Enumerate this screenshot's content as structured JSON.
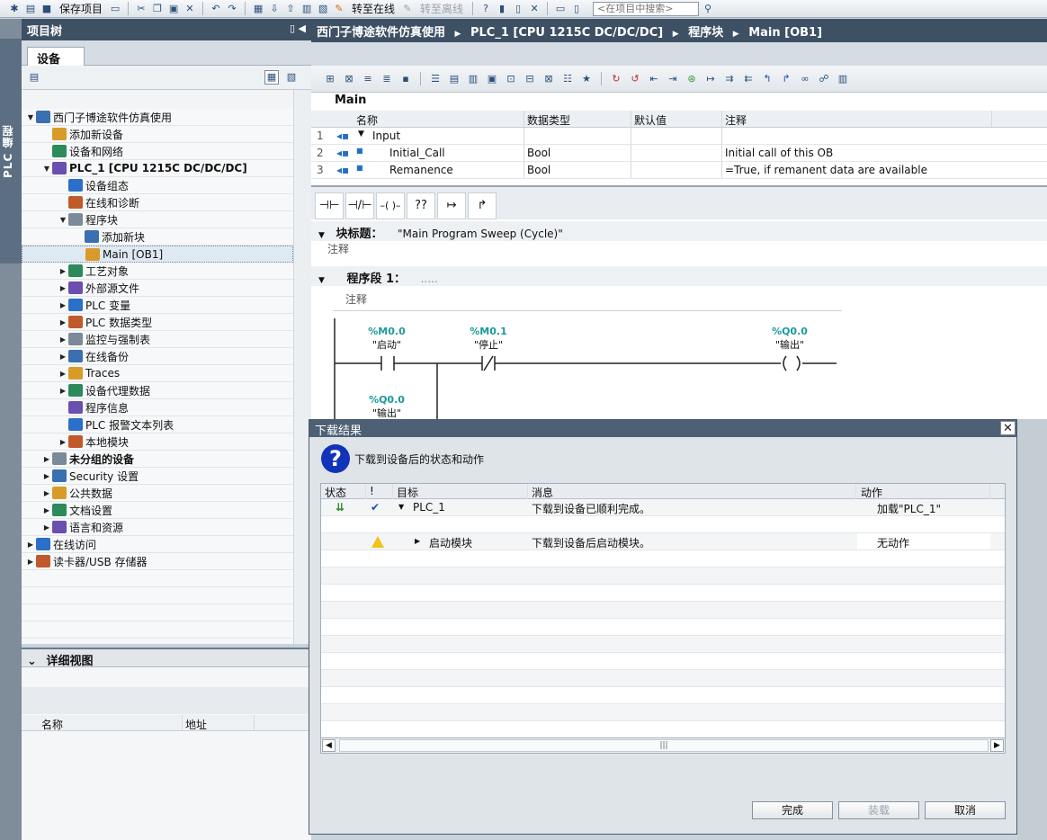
{
  "toolbar": {
    "save_project": "保存项目",
    "go_online": "转至在线",
    "go_offline": "转至离线",
    "search_placeholder": "<在项目中搜索>"
  },
  "left_strip": {
    "label": "PLC 编程"
  },
  "project_tree": {
    "title": "项目树",
    "tab": "设备",
    "items": [
      {
        "label": "西门子博途软件仿真使用",
        "level": 0,
        "expander": "down"
      },
      {
        "label": "添加新设备",
        "level": 1,
        "expander": ""
      },
      {
        "label": "设备和网络",
        "level": 1,
        "expander": ""
      },
      {
        "label": "PLC_1 [CPU 1215C DC/DC/DC]",
        "level": 1,
        "expander": "down",
        "bold": true
      },
      {
        "label": "设备组态",
        "level": 2,
        "expander": ""
      },
      {
        "label": "在线和诊断",
        "level": 2,
        "expander": ""
      },
      {
        "label": "程序块",
        "level": 2,
        "expander": "down"
      },
      {
        "label": "添加新块",
        "level": 3,
        "expander": ""
      },
      {
        "label": "Main [OB1]",
        "level": 3,
        "expander": "",
        "selected": true
      },
      {
        "label": "工艺对象",
        "level": 2,
        "expander": "right"
      },
      {
        "label": "外部源文件",
        "level": 2,
        "expander": "right"
      },
      {
        "label": "PLC 变量",
        "level": 2,
        "expander": "right"
      },
      {
        "label": "PLC 数据类型",
        "level": 2,
        "expander": "right"
      },
      {
        "label": "监控与强制表",
        "level": 2,
        "expander": "right"
      },
      {
        "label": "在线备份",
        "level": 2,
        "expander": "right"
      },
      {
        "label": "Traces",
        "level": 2,
        "expander": "right"
      },
      {
        "label": "设备代理数据",
        "level": 2,
        "expander": "right"
      },
      {
        "label": "程序信息",
        "level": 2,
        "expander": ""
      },
      {
        "label": "PLC 报警文本列表",
        "level": 2,
        "expander": ""
      },
      {
        "label": "本地模块",
        "level": 2,
        "expander": "right"
      },
      {
        "label": "未分组的设备",
        "level": 1,
        "expander": "right",
        "bold": true
      },
      {
        "label": "Security 设置",
        "level": 1,
        "expander": "right"
      },
      {
        "label": "公共数据",
        "level": 1,
        "expander": "right"
      },
      {
        "label": "文档设置",
        "level": 1,
        "expander": "right"
      },
      {
        "label": "语言和资源",
        "level": 1,
        "expander": "right"
      },
      {
        "label": "在线访问",
        "level": 0,
        "expander": "right"
      },
      {
        "label": "读卡器/USB 存储器",
        "level": 0,
        "expander": "right"
      }
    ]
  },
  "detail_view": {
    "title": "详细视图",
    "col_name": "名称",
    "col_address": "地址"
  },
  "editor": {
    "breadcrumb": [
      "西门子博途软件仿真使用",
      "PLC_1 [CPU 1215C DC/DC/DC]",
      "程序块",
      "Main [OB1]"
    ],
    "interface": {
      "title": "Main",
      "columns": [
        "名称",
        "数据类型",
        "默认值",
        "注释"
      ],
      "rows": [
        {
          "num": "1",
          "name": "Input",
          "type": "",
          "comment": ""
        },
        {
          "num": "2",
          "name": "Initial_Call",
          "type": "Bool",
          "comment": "Initial call of this OB"
        },
        {
          "num": "3",
          "name": "Remanence",
          "type": "Bool",
          "comment": "=True, if remanent data are available"
        }
      ]
    },
    "ladder_buttons": [
      "⊣⊢",
      "⊣/⊢",
      "–( )–",
      "??",
      "↦",
      "↱"
    ],
    "block_title_label": "块标题：",
    "block_title_value": "\"Main Program Sweep (Cycle)\"",
    "comment": "注释",
    "network_label": "程序段 1：",
    "network_dots": ".....",
    "network_comment": "注释",
    "contacts": [
      {
        "addr": "%M0.0",
        "name": "\"启动\""
      },
      {
        "addr": "%M0.1",
        "name": "\"停止\""
      },
      {
        "addr": "%Q0.0",
        "name": "\"输出\""
      },
      {
        "addr": "%Q0.0",
        "name": "\"输出\""
      }
    ]
  },
  "dialog": {
    "title": "下载结果",
    "subtitle": "下载到设备后的状态和动作",
    "columns": [
      "状态",
      "!",
      "目标",
      "消息",
      "动作"
    ],
    "rows": [
      {
        "target": "PLC_1",
        "message": "下载到设备已顺利完成。",
        "action": "加载\"PLC_1\""
      },
      {
        "target": "",
        "message": "",
        "action": ""
      },
      {
        "target": "启动模块",
        "message": "下载到设备后启动模块。",
        "action": "无动作"
      }
    ],
    "buttons": {
      "finish": "完成",
      "load": "装载",
      "cancel": "取消"
    }
  }
}
